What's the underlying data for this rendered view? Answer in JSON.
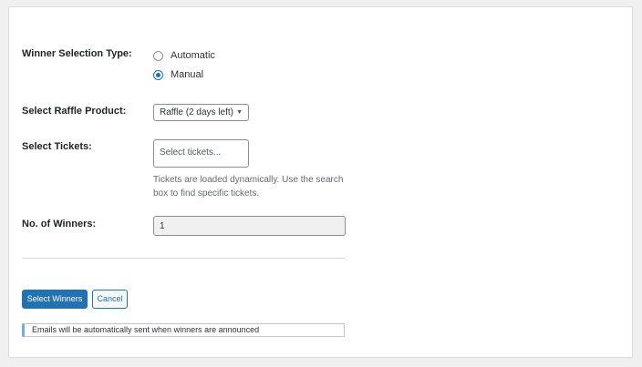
{
  "form": {
    "selection_type_label": "Winner Selection Type:",
    "radio_options": [
      {
        "label": "Automatic",
        "checked": false
      },
      {
        "label": "Manual",
        "checked": true
      }
    ],
    "product_label": "Select Raffle Product:",
    "product_selected": "Raffle (2 days left)",
    "tickets_label": "Select Tickets:",
    "tickets_placeholder": "Select tickets...",
    "tickets_help": "Tickets are loaded dynamically. Use the search box to find specific tickets.",
    "winners_label": "No. of Winners:",
    "winners_value": "1"
  },
  "actions": {
    "select_winners_label": "Select Winners",
    "cancel_label": "Cancel"
  },
  "notice": {
    "text": "Emails will be automatically sent when winners are announced"
  },
  "colors": {
    "accent": "#2271b1",
    "notice_border": "#72aee6",
    "background": "#f0f0f1"
  }
}
